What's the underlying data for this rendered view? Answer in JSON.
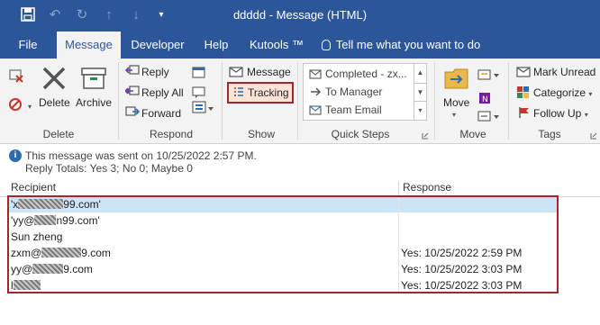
{
  "window": {
    "title": "ddddd  -  Message (HTML)"
  },
  "tabs": [
    {
      "label": "File"
    },
    {
      "label": "Message"
    },
    {
      "label": "Developer"
    },
    {
      "label": "Help"
    },
    {
      "label": "Kutools ™"
    },
    {
      "label": "Tell me what you want to do"
    }
  ],
  "ribbon": {
    "delete_group": {
      "delete_label": "Delete",
      "archive_label": "Archive",
      "group_label": "Delete"
    },
    "respond_group": {
      "reply_label": "Reply",
      "reply_all_label": "Reply All",
      "forward_label": "Forward",
      "group_label": "Respond"
    },
    "show_group": {
      "message_label": "Message",
      "tracking_label": "Tracking",
      "group_label": "Show"
    },
    "quick_steps": {
      "items": [
        "Completed - zx...",
        "To Manager",
        "Team Email"
      ],
      "group_label": "Quick Steps"
    },
    "move_group": {
      "move_label": "Move",
      "group_label": "Move"
    },
    "tags_group": {
      "mark_unread_label": "Mark Unread",
      "categorize_label": "Categorize",
      "follow_up_label": "Follow Up",
      "group_label": "Tags"
    }
  },
  "info": {
    "sent_line": "This message was sent on 10/25/2022 2:57 PM.",
    "totals_line": "Reply Totals: Yes 3; No 0; Maybe 0"
  },
  "table": {
    "headers": {
      "recipient": "Recipient",
      "response": "Response"
    },
    "rows": [
      {
        "pre": "'x",
        "post": "99.com'",
        "response": ""
      },
      {
        "pre": "'yy@",
        "post": "n99.com'",
        "response": ""
      },
      {
        "pre": "Sun zheng",
        "post": "",
        "response": ""
      },
      {
        "pre": "zxm@",
        "post": "9.com",
        "response": "Yes: 10/25/2022 2:59 PM"
      },
      {
        "pre": "yy@",
        "post": "9.com",
        "response": "Yes: 10/25/2022 3:03 PM"
      },
      {
        "pre": "l",
        "post": "",
        "response": "Yes: 10/25/2022 3:03 PM"
      }
    ]
  },
  "colors": {
    "title_bar": "#2b579a",
    "ribbon_bg": "#f3f3f3",
    "highlight_border": "#a4262c",
    "selected_row": "#cce4f7"
  }
}
